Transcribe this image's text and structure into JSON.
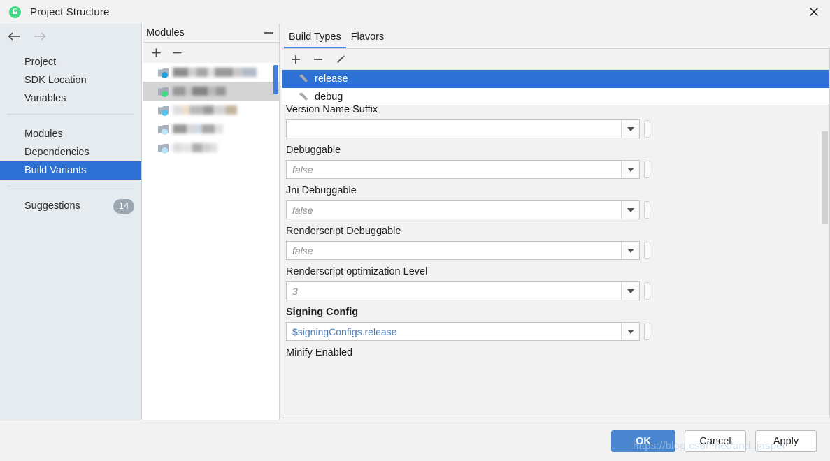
{
  "window": {
    "title": "Project Structure",
    "app_icon": "android-logo-icon",
    "close_icon": "close-icon"
  },
  "nav": {
    "back_icon": "arrow-left-icon",
    "forward_icon": "arrow-right-icon"
  },
  "sidebar": {
    "groups": [
      {
        "items": [
          {
            "label": "Project",
            "selected": false
          },
          {
            "label": "SDK Location",
            "selected": false
          },
          {
            "label": "Variables",
            "selected": false
          }
        ]
      },
      {
        "items": [
          {
            "label": "Modules",
            "selected": false
          },
          {
            "label": "Dependencies",
            "selected": false
          },
          {
            "label": "Build Variants",
            "selected": true
          }
        ]
      },
      {
        "items": [
          {
            "label": "Suggestions",
            "selected": false,
            "badge": "14"
          }
        ]
      }
    ]
  },
  "modules_panel": {
    "title": "Modules",
    "collapse_icon": "minimize-icon",
    "toolbar": [
      {
        "name": "add-module-button",
        "icon": "plus-icon"
      },
      {
        "name": "remove-module-button",
        "icon": "minus-icon"
      }
    ],
    "rows": [
      {
        "icon_color": "blue",
        "selected": false,
        "redacted": true
      },
      {
        "icon_color": "green",
        "selected": true,
        "redacted": true
      },
      {
        "icon_color": "lightblue",
        "selected": false,
        "redacted": true
      },
      {
        "icon_color": "pale",
        "selected": false,
        "redacted": true
      },
      {
        "icon_color": "pale",
        "selected": false,
        "redacted": true
      }
    ]
  },
  "main": {
    "tabs": [
      {
        "label": "Build Types",
        "active": true
      },
      {
        "label": "Flavors",
        "active": false
      }
    ],
    "toolbar": [
      {
        "name": "add-build-type-button",
        "icon": "plus-icon"
      },
      {
        "name": "remove-build-type-button",
        "icon": "minus-icon"
      },
      {
        "name": "edit-build-type-button",
        "icon": "pencil-icon"
      }
    ],
    "build_types": [
      {
        "label": "release",
        "selected": true,
        "icon": "build-type-icon"
      },
      {
        "label": "debug",
        "selected": false,
        "icon": "build-type-icon"
      }
    ],
    "fields": [
      {
        "label": "Version Name Suffix",
        "value": "",
        "placeholder": "",
        "bold": false,
        "clipped_top": true,
        "has_value": false
      },
      {
        "label": "Debuggable",
        "value": "false",
        "bold": false,
        "has_value": false
      },
      {
        "label": "Jni Debuggable",
        "value": "false",
        "bold": false,
        "has_value": false
      },
      {
        "label": "Renderscript Debuggable",
        "value": "false",
        "bold": false,
        "has_value": false
      },
      {
        "label": "Renderscript optimization Level",
        "value": "3",
        "bold": false,
        "has_value": false
      },
      {
        "label": "Signing Config",
        "value": "$signingConfigs.release",
        "bold": true,
        "has_value": true
      },
      {
        "label": "Minify Enabled",
        "value": "",
        "bold": false,
        "clipped_bottom": true,
        "has_value": false
      }
    ]
  },
  "footer": {
    "ok_label": "OK",
    "cancel_label": "Cancel",
    "apply_label": "Apply"
  },
  "watermark": {
    "text": "https://blog.csdn.net/and_jasper"
  },
  "colors": {
    "selection_blue": "#2d71d5",
    "primary_button": "#4a86cf",
    "sidebar_bg": "#e6ebef",
    "panel_bg": "#f2f2f2",
    "value_link": "#4a7ebb",
    "badge_gray": "#9aa7b3",
    "android_green": "#3ddc84"
  }
}
